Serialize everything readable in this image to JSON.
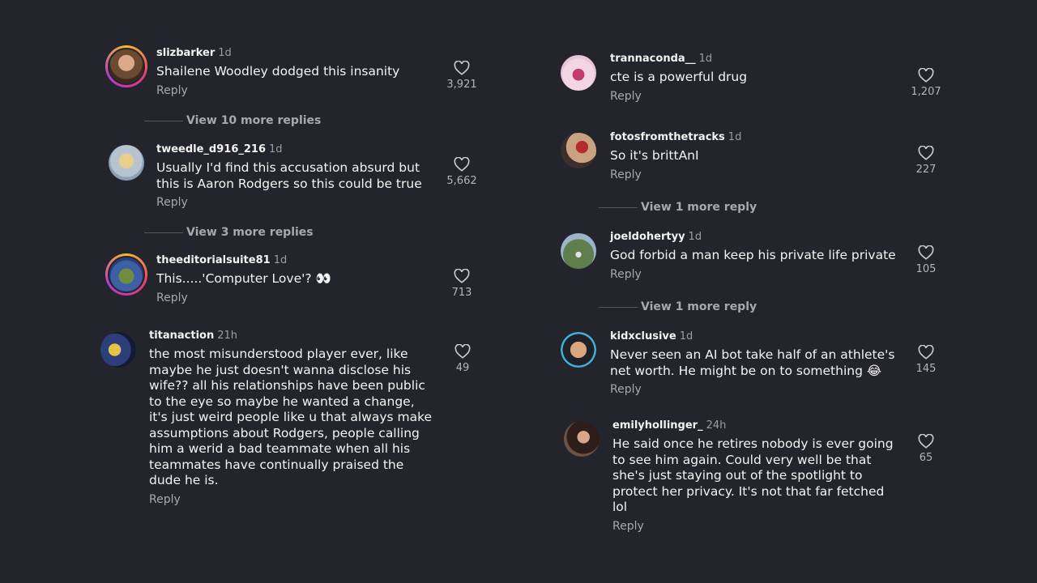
{
  "left": [
    {
      "username": "slizbarker",
      "time": "1d",
      "text": "Shailene Woodley dodged this insanity",
      "reply": "Reply",
      "likes": "3,921"
    },
    {
      "username": "tweedle_d916_216",
      "time": "1d",
      "text": "Usually I'd find this accusation absurd but\nthis is Aaron Rodgers so this could be true",
      "reply": "Reply",
      "likes": "5,662"
    },
    {
      "username": "theeditorialsuite81",
      "time": "1d",
      "text": "This.....'Computer Love'? 👀",
      "reply": "Reply",
      "likes": "713"
    },
    {
      "username": "titanaction",
      "time": "21h",
      "text": "the most misunderstood player ever, like\nmaybe he just doesn't wanna disclose his\nwife?? all his relationships have been public\nto the eye so maybe he wanted a change,\nit's just weird people like u that always make\nassumptions about Rodgers, people calling\nhim a werid a bad teammate when all his\nteammates have continually praised the\ndude he is.",
      "reply": "Reply",
      "likes": "49"
    }
  ],
  "left_view_more": [
    "View 10 more replies",
    "View 3 more replies"
  ],
  "right": [
    {
      "username": "trannaconda__",
      "time": "1d",
      "text": "cte is a powerful drug",
      "reply": "Reply",
      "likes": "1,207"
    },
    {
      "username": "fotosfromthetracks",
      "time": "1d",
      "text": "So it's brittAnI",
      "reply": "Reply",
      "likes": "227"
    },
    {
      "username": "joeldohertyy",
      "time": "1d",
      "text": "God forbid a man keep his private life private",
      "reply": "Reply",
      "likes": "105"
    },
    {
      "username": "kidxclusive",
      "time": "1d",
      "text": "Never seen an AI bot take half of an athlete's\nnet worth. He might be on to something 😂",
      "reply": "Reply",
      "likes": "145"
    },
    {
      "username": "emilyhollinger_",
      "time": "24h",
      "text": "He said once he retires nobody is ever going\nto see him again.  Could very well be that\nshe's just staying out of the spotlight to\nprotect her privacy.  It's not that far fetched\nlol",
      "reply": "Reply",
      "likes": "65"
    }
  ],
  "right_view_more": [
    "View 1 more reply",
    "View 1 more reply"
  ],
  "colors": {
    "background": "#24252c",
    "text": "#f2f2f2",
    "muted": "#a8a8b0"
  },
  "icons": {
    "like": "heart-outline-icon"
  }
}
